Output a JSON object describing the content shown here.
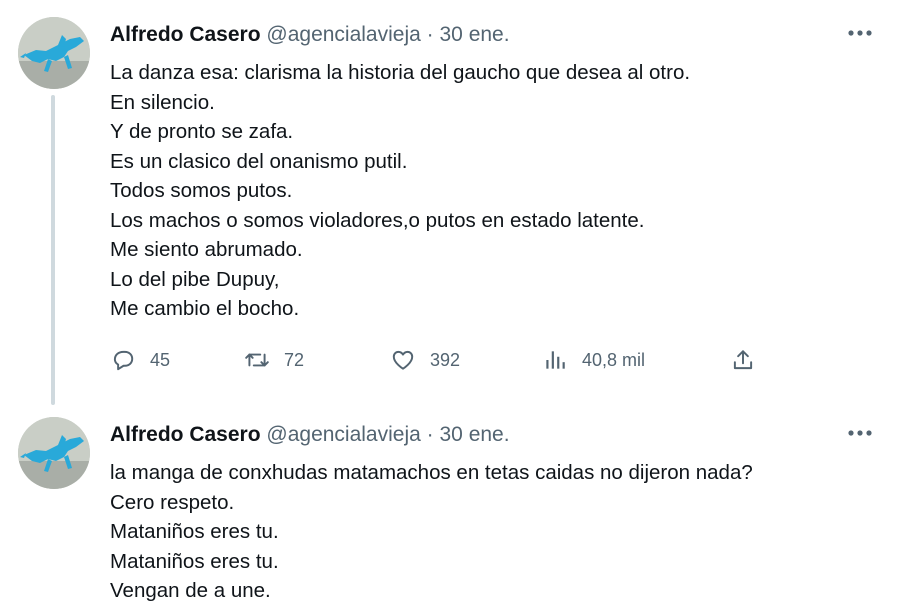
{
  "tweets": [
    {
      "author": {
        "name": "Alfredo Casero",
        "handle": "@agencialavieja"
      },
      "separator": "·",
      "date": "30 ene.",
      "more_icon": "more-horizontal-icon",
      "lines": [
        "La danza esa: clarisma la historia del gaucho que desea al otro.",
        "En silencio.",
        "Y de pronto se zafa.",
        "Es un clasico del onanismo putil.",
        "Todos somos putos.",
        "Los machos o somos violadores,o putos en estado latente.",
        "Me siento abrumado.",
        "Lo del pibe Dupuy,",
        "Me cambio el bocho."
      ],
      "actions": {
        "replies": "45",
        "retweets": "72",
        "likes": "392",
        "views": "40,8 mil"
      }
    },
    {
      "author": {
        "name": "Alfredo Casero",
        "handle": "@agencialavieja"
      },
      "separator": "·",
      "date": "30 ene.",
      "more_icon": "more-horizontal-icon",
      "lines": [
        "la manga de conxhudas matamachos en tetas caidas no dijeron nada?",
        "Cero respeto.",
        "Mataniños eres tu.",
        "Mataniños eres tu.",
        "Vengan de a une."
      ]
    }
  ],
  "colors": {
    "text_primary": "#0f1419",
    "text_secondary": "#536471",
    "thread_line": "#cfd9de",
    "avatar_figure": "#29a9d9"
  },
  "icons": [
    "reply-icon",
    "retweet-icon",
    "like-icon",
    "views-icon",
    "share-icon",
    "more-horizontal-icon"
  ]
}
